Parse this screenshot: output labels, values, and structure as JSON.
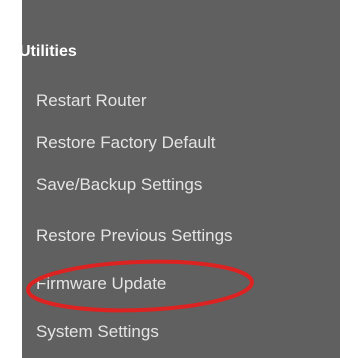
{
  "sidebar": {
    "section_title": "Utilities",
    "items": [
      {
        "label": "Restart Router"
      },
      {
        "label": "Restore Factory Default"
      },
      {
        "label": "Save/Backup Settings"
      },
      {
        "label": "Restore Previous Settings"
      },
      {
        "label": "Firmware Update",
        "highlighted": true
      },
      {
        "label": "System Settings"
      }
    ]
  },
  "colors": {
    "panel_background": "#606060",
    "section_title": "#ffffff",
    "menu_text": "#e4e4e4",
    "highlight_ring": "#dd2222"
  }
}
